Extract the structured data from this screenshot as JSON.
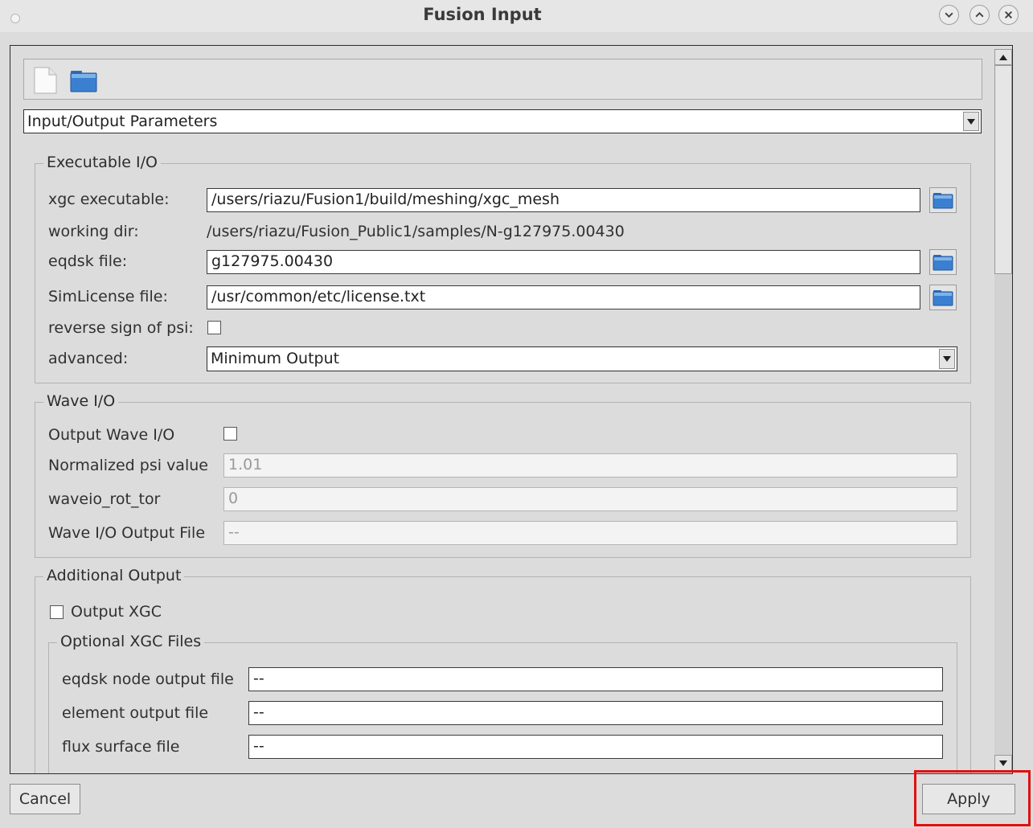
{
  "window": {
    "title": "Fusion Input"
  },
  "section_selector": {
    "value": "Input/Output Parameters"
  },
  "executable_io": {
    "legend": "Executable I/O",
    "xgc_executable": {
      "label": "xgc executable:",
      "value": "/users/riazu/Fusion1/build/meshing/xgc_mesh"
    },
    "working_dir": {
      "label": "working dir:",
      "value": "/users/riazu/Fusion_Public1/samples/N-g127975.00430"
    },
    "eqdsk_file": {
      "label": "eqdsk file:",
      "value": "g127975.00430"
    },
    "simlicense_file": {
      "label": "SimLicense file:",
      "value": "/usr/common/etc/license.txt"
    },
    "reverse_sign": {
      "label": "reverse sign of psi:",
      "checked": false
    },
    "advanced": {
      "label": "advanced:",
      "value": "Minimum Output"
    }
  },
  "wave_io": {
    "legend": "Wave I/O",
    "output_wave_io": {
      "label": "Output Wave I/O",
      "checked": false
    },
    "normalized_psi": {
      "label": "Normalized psi value",
      "value": "1.01"
    },
    "waveio_rot_tor": {
      "label": "waveio_rot_tor",
      "value": "0"
    },
    "output_file": {
      "label": "Wave I/O Output File",
      "value": "--"
    }
  },
  "additional_output": {
    "legend": "Additional Output",
    "output_xgc": {
      "label": "Output XGC",
      "checked": false
    },
    "optional_files": {
      "legend": "Optional XGC Files",
      "eqdsk_node_output": {
        "label": "eqdsk node output file",
        "value": "--"
      },
      "element_output": {
        "label": "element output file",
        "value": "--"
      },
      "flux_surface": {
        "label": "flux surface file",
        "value": "--"
      }
    }
  },
  "buttons": {
    "cancel": "Cancel",
    "apply": "Apply"
  },
  "icons": {
    "new": "new-file-icon",
    "open": "open-folder-icon",
    "browse": "folder-icon",
    "minimize": "chevron-down-icon",
    "maximize": "chevron-up-icon",
    "close": "close-icon"
  },
  "colors": {
    "highlight": "#e01010",
    "folder_blue": "#3b80d0"
  }
}
